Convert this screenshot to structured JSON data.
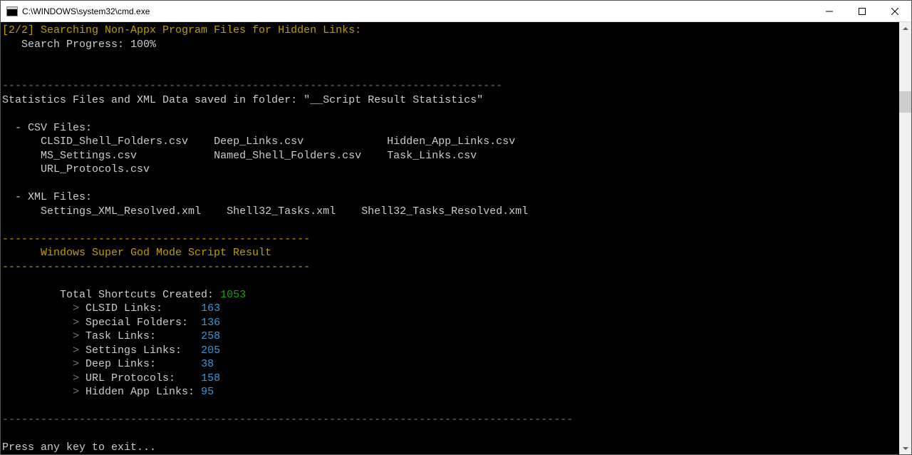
{
  "window": {
    "title": "C:\\WINDOWS\\system32\\cmd.exe"
  },
  "terminal": {
    "search_line": "[2/2] Searching Non-Appx Program Files for Hidden Links:",
    "progress_label": "   Search Progress: ",
    "progress_value": "100%",
    "divider_medium": "------------------------------------------------------------------------------",
    "stats_saved_line": "Statistics Files and XML Data saved in folder: \"__Script Result Statistics\"",
    "csv_header": "  - CSV Files:",
    "csv_row1_a": "      CLSID_Shell_Folders.csv",
    "csv_row1_b": "Deep_Links.csv",
    "csv_row1_c": "Hidden_App_Links.csv",
    "csv_row2_a": "      MS_Settings.csv",
    "csv_row2_b": "Named_Shell_Folders.csv",
    "csv_row2_c": "Task_Links.csv",
    "csv_row3_a": "      URL_Protocols.csv",
    "xml_header": "  - XML Files:",
    "xml_row1_a": "      Settings_XML_Resolved.xml",
    "xml_row1_b": "Shell32_Tasks.xml",
    "xml_row1_c": "Shell32_Tasks_Resolved.xml",
    "result_divider": "------------------------------------------------",
    "result_title": "      Windows Super God Mode Script Result",
    "total_label": "         Total Shortcuts Created: ",
    "total_value": "1053",
    "rows": [
      {
        "arrow": "           > ",
        "label": "CLSID Links:      ",
        "value": "163"
      },
      {
        "arrow": "           > ",
        "label": "Special Folders:  ",
        "value": "136"
      },
      {
        "arrow": "           > ",
        "label": "Task Links:       ",
        "value": "258"
      },
      {
        "arrow": "           > ",
        "label": "Settings Links:   ",
        "value": "205"
      },
      {
        "arrow": "           > ",
        "label": "Deep Links:       ",
        "value": "38"
      },
      {
        "arrow": "           > ",
        "label": "URL Protocols:    ",
        "value": "158"
      },
      {
        "arrow": "           > ",
        "label": "Hidden App Links: ",
        "value": "95"
      }
    ],
    "divider_long": "-----------------------------------------------------------------------------------------",
    "exit_prompt": "Press any key to exit..."
  }
}
